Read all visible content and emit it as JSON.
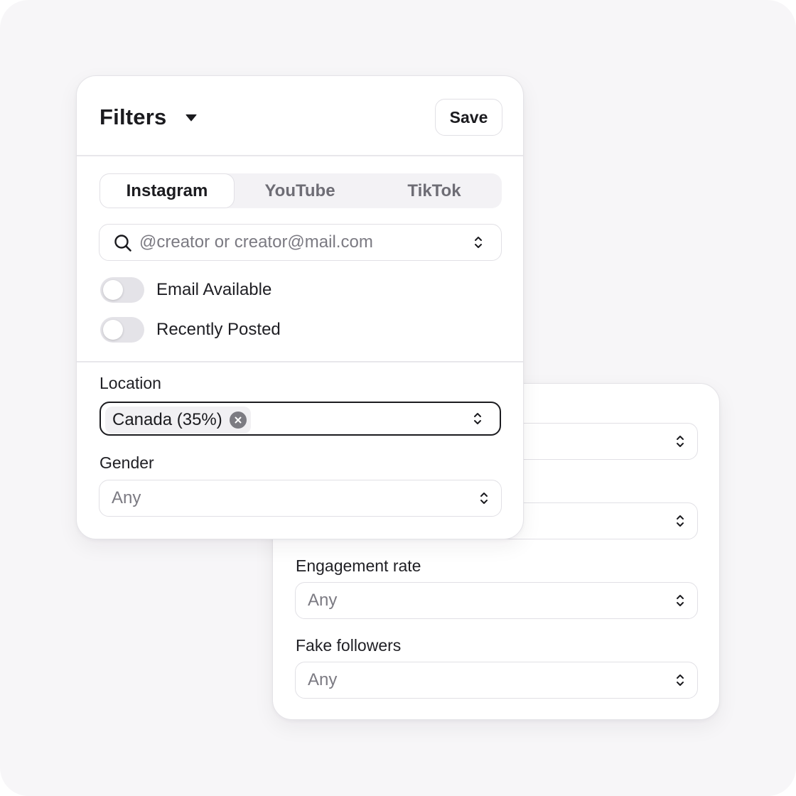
{
  "filters_panel": {
    "title": "Filters",
    "save_label": "Save",
    "platform_tabs": [
      {
        "label": "Instagram",
        "active": true
      },
      {
        "label": "YouTube",
        "active": false
      },
      {
        "label": "TikTok",
        "active": false
      }
    ],
    "search": {
      "placeholder": "@creator or creator@mail.com",
      "value": ""
    },
    "toggles": [
      {
        "label": "Email Available",
        "on": false
      },
      {
        "label": "Recently Posted",
        "on": false
      }
    ],
    "location": {
      "label": "Location",
      "selected_chip": "Canada (35%)"
    },
    "gender": {
      "label": "Gender",
      "value": "Any"
    }
  },
  "secondary_panel": {
    "engagement_rate": {
      "label": "Engagement rate",
      "value": "Any"
    },
    "fake_followers": {
      "label": "Fake followers",
      "value": "Any"
    }
  },
  "icons": {
    "caret": "caret-down-icon",
    "search": "search-icon",
    "chevron": "chevron-up-down-icon",
    "chip_remove": "close-circle-icon"
  },
  "colors": {
    "background": "#f7f6f8",
    "card": "#ffffff",
    "border": "#e1e0e5",
    "text_primary": "#1b1b1f",
    "text_muted": "#7b7a82",
    "toggle_off": "#e4e3e8",
    "focused_border": "#1b1b1f"
  }
}
